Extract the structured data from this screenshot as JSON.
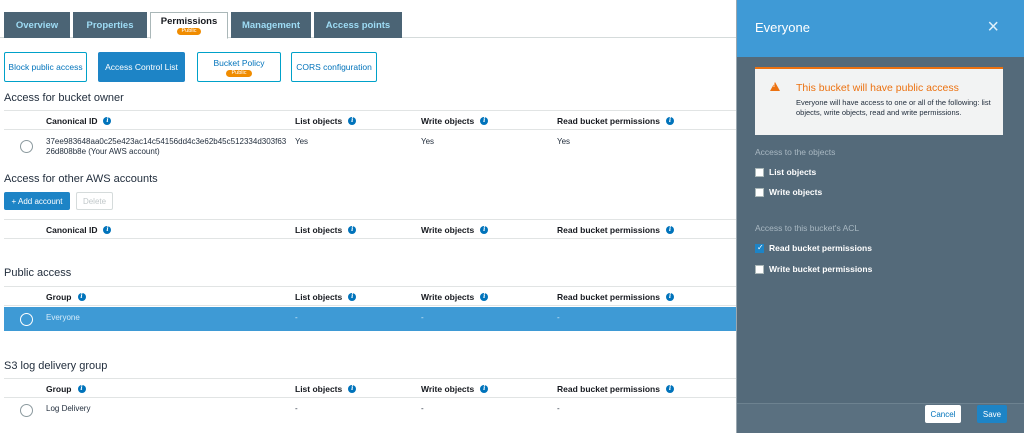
{
  "tabs": [
    {
      "label": "Overview"
    },
    {
      "label": "Properties"
    },
    {
      "label": "Permissions",
      "badge": "Public"
    },
    {
      "label": "Management"
    },
    {
      "label": "Access points"
    }
  ],
  "subnav": {
    "block_public_access": "Block public access",
    "acl": "Access Control List",
    "bucket_policy": "Bucket Policy",
    "bucket_policy_badge": "Public",
    "cors": "CORS configuration"
  },
  "owner_section": {
    "title": "Access for bucket owner",
    "headers": {
      "id": "Canonical ID",
      "list": "List objects",
      "write": "Write objects",
      "read": "Read bucket permissions"
    },
    "row": {
      "id_line1": "37ee983648aa0c25e423ac14c54156dd4c3e62b45c512334d303f63",
      "id_line2": "26d808b8e (Your AWS account)",
      "list": "Yes",
      "write": "Yes",
      "read": "Yes"
    }
  },
  "other_section": {
    "title": "Access for other AWS accounts",
    "add_button": "+ Add account",
    "delete_button": "Delete",
    "headers": {
      "id": "Canonical ID",
      "list": "List objects",
      "write": "Write objects",
      "read": "Read bucket permissions"
    }
  },
  "public_section": {
    "title": "Public access",
    "headers": {
      "group": "Group",
      "list": "List objects",
      "write": "Write objects",
      "read": "Read bucket permissions"
    },
    "row": {
      "group": "Everyone",
      "list": "-",
      "write": "-",
      "read": "-"
    }
  },
  "log_section": {
    "title": "S3 log delivery group",
    "headers": {
      "group": "Group",
      "list": "List objects",
      "write": "Write objects",
      "read": "Read bucket permissions"
    },
    "row": {
      "group": "Log Delivery",
      "list": "-",
      "write": "-",
      "read": "-"
    }
  },
  "panel": {
    "title": "Everyone",
    "close_icon": "×",
    "alert_title": "This bucket will have public access",
    "alert_text": "Everyone will have access to one or all of the following: list objects, write objects, read and write permissions.",
    "objects_label": "Access to the objects",
    "list_objects": "List objects",
    "write_objects": "Write objects",
    "acl_label": "Access to this bucket's ACL",
    "read_permissions": "Read bucket permissions",
    "write_permissions": "Write bucket permissions",
    "cancel": "Cancel",
    "save": "Save"
  },
  "icons": {
    "info": "i"
  }
}
